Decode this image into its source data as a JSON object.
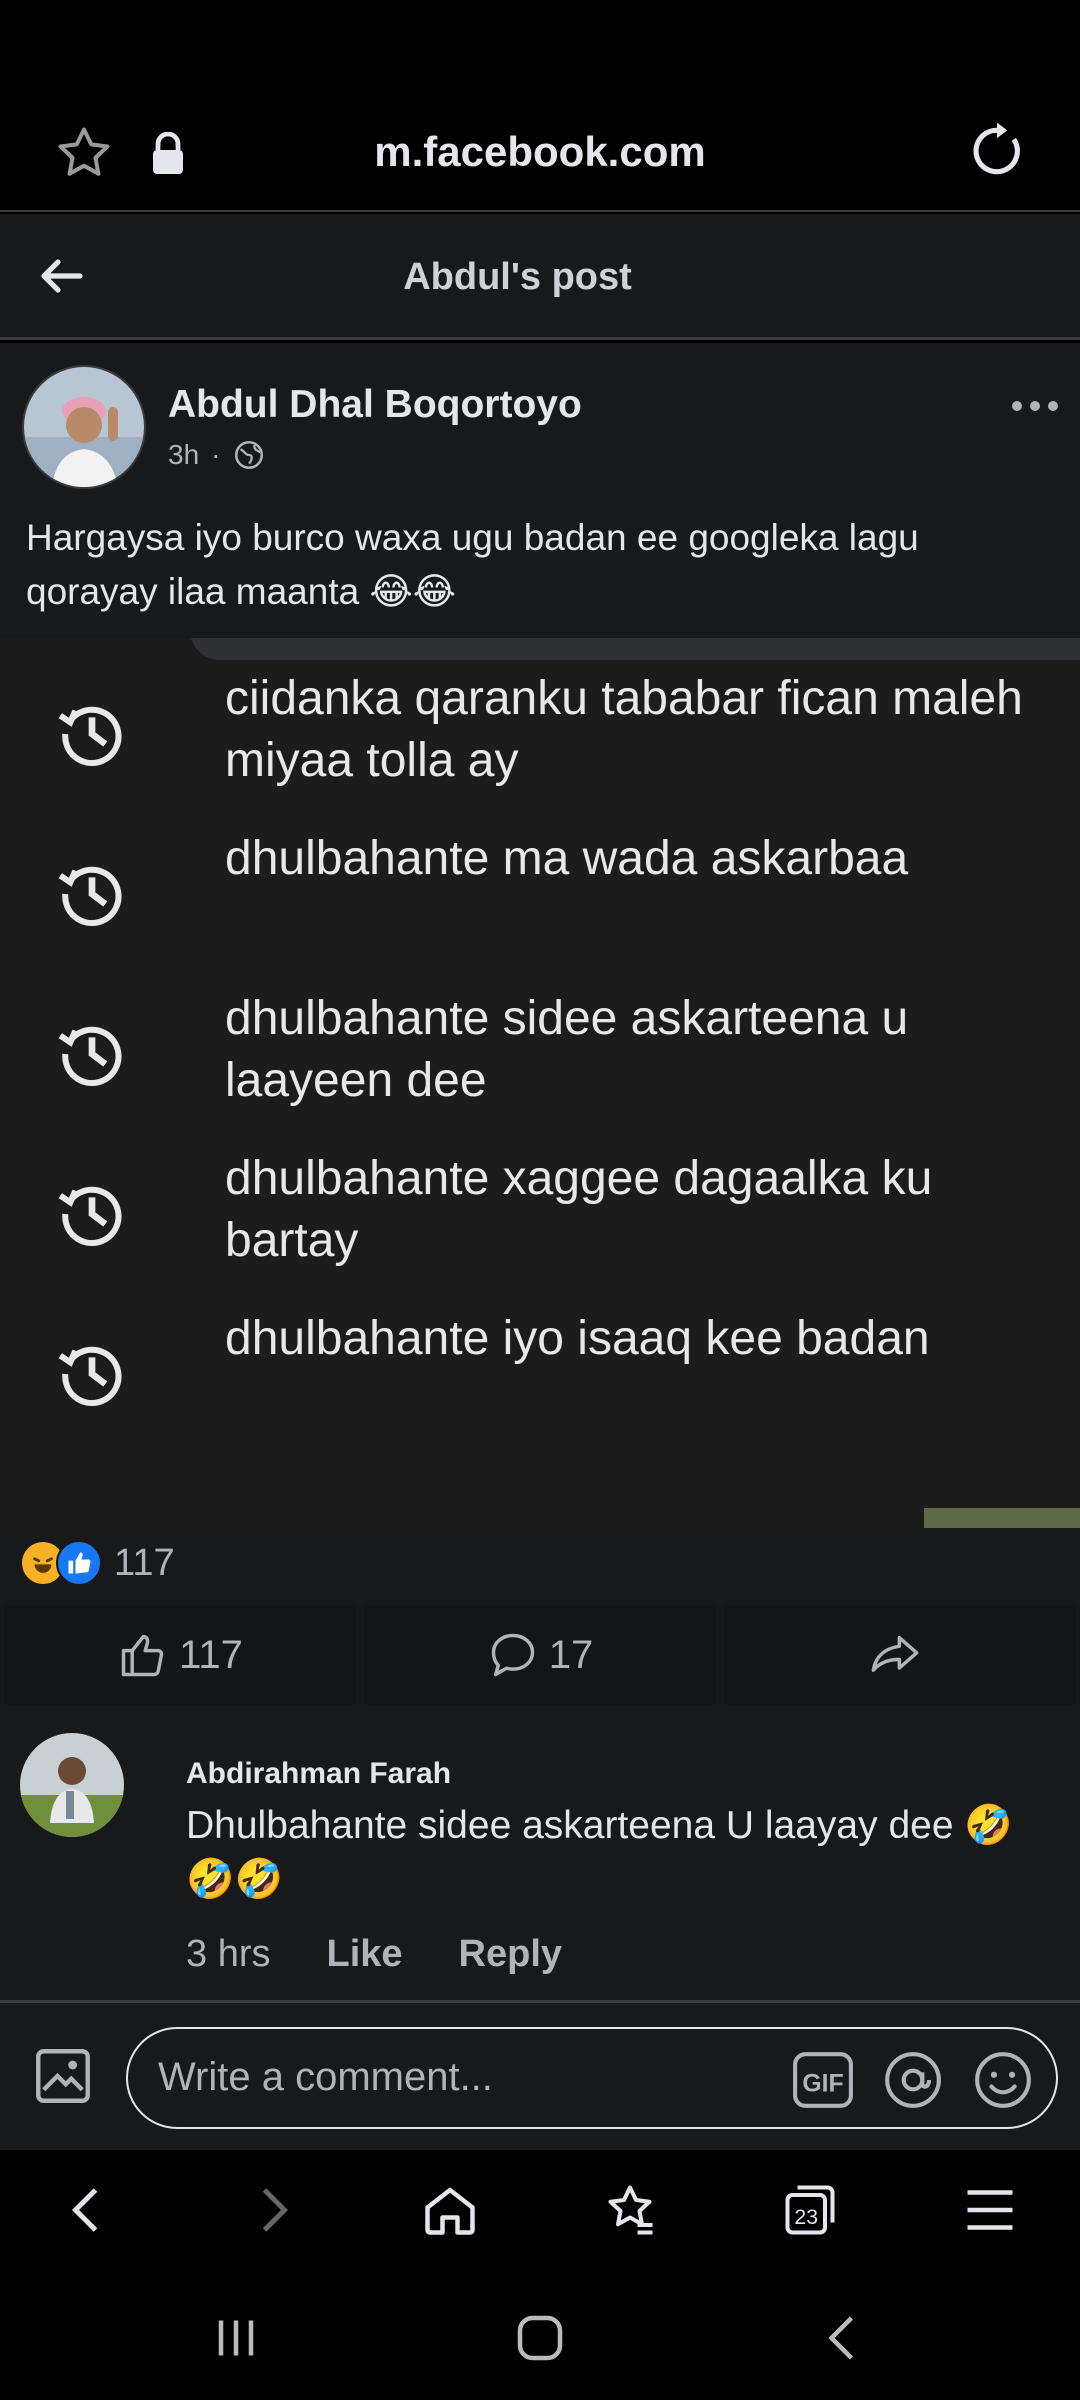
{
  "browser": {
    "url": "m.facebook.com"
  },
  "header": {
    "title": "Abdul's post"
  },
  "post": {
    "author": "Abdul Dhal Boqortoyo",
    "time": "3h",
    "text": "Hargaysa iyo burco waxa ugu badan ee googleka lagu qorayay ilaa maanta 😂😂",
    "suggestions": [
      "ciidanka qaranku tababar fican maleh miyaa tolla ay",
      "dhulbahante ma wada askarbaa",
      "dhulbahante sidee askarteena u laayeen dee",
      "dhulbahante xaggee dagaalka ku bartay",
      "dhulbahante iyo isaaq kee badan"
    ],
    "reaction_count": "117",
    "like_count": "117",
    "comment_count": "17"
  },
  "comment": {
    "author": "Abdirahman Farah",
    "text": "Dhulbahante sidee askarteena U laayay dee 🤣🤣🤣",
    "time": "3 hrs",
    "like_label": "Like",
    "reply_label": "Reply"
  },
  "composer": {
    "placeholder": "Write a comment..."
  },
  "tab_count": "23",
  "colors": {
    "background": "#18191a",
    "like_blue": "#1877f2",
    "haha_yellow": "#f7b125"
  }
}
